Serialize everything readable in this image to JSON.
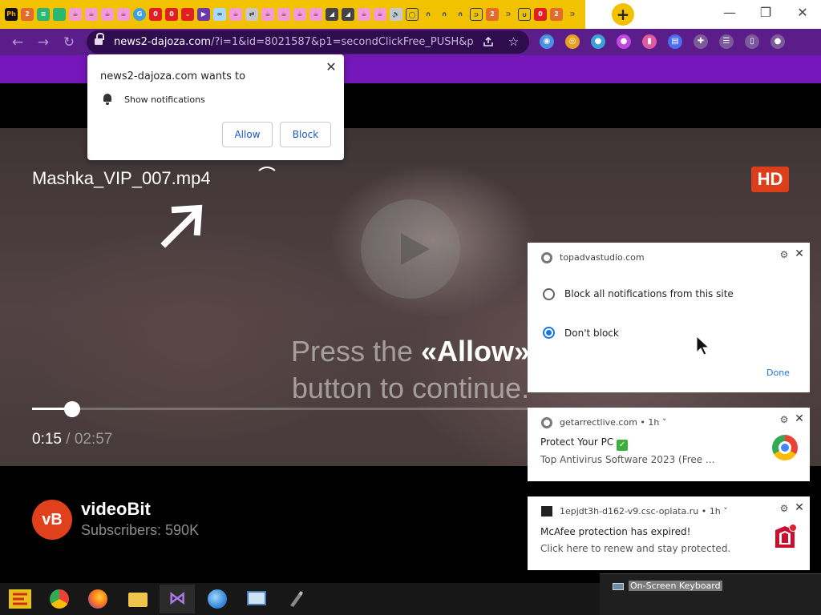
{
  "browser": {
    "tabs": [
      {
        "glyph": "Ph",
        "kind": "ph"
      },
      {
        "glyph": "2",
        "kind": "fa"
      },
      {
        "glyph": "≡",
        "kind": "sh"
      },
      {
        "glyph": "",
        "kind": "sh"
      },
      {
        "glyph": "☕",
        "kind": "sm"
      },
      {
        "glyph": "☕",
        "kind": "sm"
      },
      {
        "glyph": "☕",
        "kind": "sm"
      },
      {
        "glyph": "☕",
        "kind": "sm"
      },
      {
        "glyph": "G",
        "kind": "gc"
      },
      {
        "glyph": "0",
        "kind": "rd"
      },
      {
        "glyph": "0",
        "kind": "rd"
      },
      {
        "glyph": "⌄",
        "kind": "rd"
      },
      {
        "glyph": "▶",
        "kind": "vo"
      },
      {
        "glyph": "∞",
        "kind": "pr"
      },
      {
        "glyph": "☕",
        "kind": "sm"
      },
      {
        "glyph": "⇄",
        "kind": "sp"
      },
      {
        "glyph": "☕",
        "kind": "sm"
      },
      {
        "glyph": "☕",
        "kind": "sm"
      },
      {
        "glyph": "☕",
        "kind": "sm"
      },
      {
        "glyph": "☕",
        "kind": "sm"
      },
      {
        "glyph": "◢",
        "kind": "au"
      },
      {
        "glyph": "◢",
        "kind": "au"
      },
      {
        "glyph": "☕",
        "kind": "sm"
      },
      {
        "glyph": "☕",
        "kind": "sm"
      },
      {
        "glyph": "🔊",
        "kind": "sp"
      },
      {
        "glyph": "◯",
        "kind": "wv"
      },
      {
        "glyph": "∩",
        "kind": "cr"
      },
      {
        "glyph": "∩",
        "kind": "cr"
      },
      {
        "glyph": "∩",
        "kind": "cr"
      },
      {
        "glyph": "⊃",
        "kind": "wv"
      },
      {
        "glyph": "2",
        "kind": "fa"
      },
      {
        "glyph": "⊃",
        "kind": "cr"
      },
      {
        "glyph": "∪",
        "kind": "wv"
      },
      {
        "glyph": "0",
        "kind": "rd"
      },
      {
        "glyph": "2",
        "kind": "fa"
      },
      {
        "glyph": "⊃",
        "kind": "cr"
      }
    ],
    "new_tab_label": "+",
    "window": {
      "minimize": "—",
      "maximize": "❐",
      "close": "✕"
    },
    "nav": {
      "back": "←",
      "forward": "→",
      "reload": "↻"
    },
    "url_host": "news2-dajoza.com",
    "url_rest": "/?i=1&id=8021587&p1=secondClickFree_PUSH&p...",
    "extensions": [
      {
        "icon": "eye-extension-icon",
        "glyph": "◉",
        "color": "#4a90e2"
      },
      {
        "icon": "target-extension-icon",
        "glyph": "◎",
        "color": "#e8a020"
      },
      {
        "icon": "globe-extension-icon",
        "glyph": "●",
        "color": "#3aa0d8"
      },
      {
        "icon": "orb-extension-icon",
        "glyph": "●",
        "color": "#c048e0"
      },
      {
        "icon": "bars-extension-icon",
        "glyph": "▮",
        "color": "#e05aa0"
      },
      {
        "icon": "docs-extension-icon",
        "glyph": "▤",
        "color": "#4a6ef0"
      },
      {
        "icon": "puzzle-icon",
        "glyph": "✚",
        "color": "#7a5a9a"
      },
      {
        "icon": "reading-list-icon",
        "glyph": "☰",
        "color": "#7a5a9a"
      },
      {
        "icon": "side-panel-icon",
        "glyph": "▯",
        "color": "#7a5a9a"
      },
      {
        "icon": "profile-avatar-icon",
        "glyph": "●",
        "color": "#7a5a9a"
      }
    ]
  },
  "permission_prompt": {
    "title": "news2-dajoza.com wants to",
    "item": "Show notifications",
    "allow": "Allow",
    "block": "Block",
    "close": "✕"
  },
  "video": {
    "title": "Mashka_VIP_007.mp4",
    "badge": "HD",
    "cta_pre": "Press the ",
    "cta_bold": "«Allow»",
    "cta_line2": "button to continue.",
    "current_time": "0:15",
    "duration": " / 02:57",
    "progress": 0.053
  },
  "channel": {
    "avatar": "vB",
    "name": "videoBit",
    "subscribers": "Subscribers: 590K"
  },
  "notif_settings": {
    "site": "topadvastudio.com",
    "options": [
      "Block all notifications from this site",
      "Don't block"
    ],
    "done": "Done"
  },
  "toasts": [
    {
      "site": "getarrectlive.com",
      "age": " • 1h ˅",
      "line1": "Protect Your PC ",
      "line1_check": "✓",
      "line2": "Top Antivirus Software 2023 (Free ..."
    },
    {
      "site": "1epjdt3h-d162-v9.csc-oplata.ru",
      "age": " • 1h ˅",
      "line1": "McAfee protection has expired!",
      "line2": "Click here to renew and stay protected."
    }
  ],
  "toast_icons": {
    "gear": "⚙",
    "close": "✕"
  },
  "osk": {
    "label": "On-Screen Keyboard"
  }
}
